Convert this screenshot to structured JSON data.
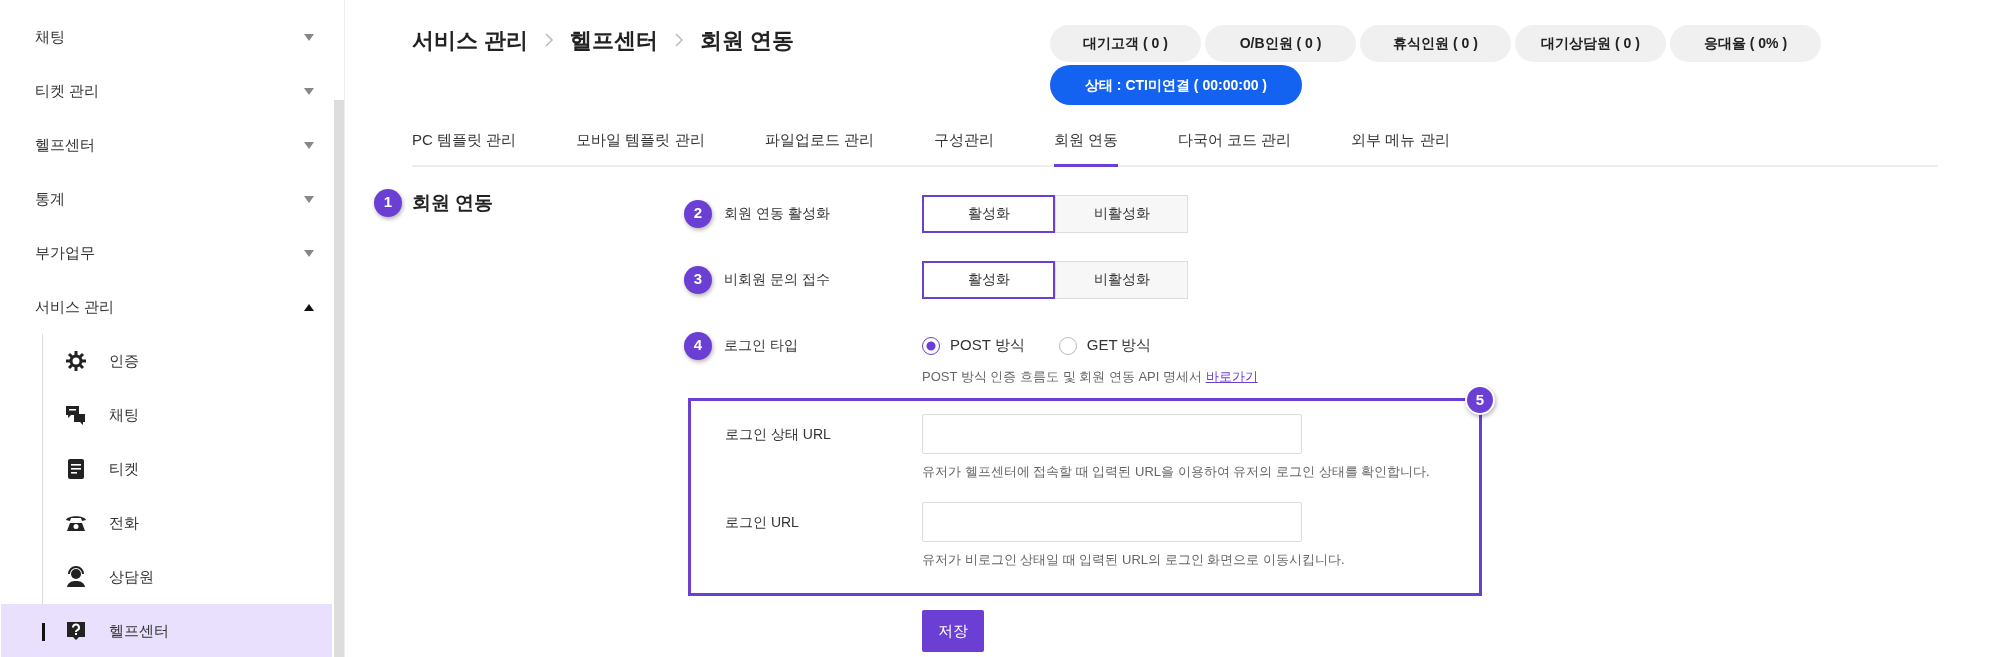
{
  "sidebar": {
    "items": [
      {
        "label": "채팅",
        "expanded": false
      },
      {
        "label": "티켓 관리",
        "expanded": false
      },
      {
        "label": "헬프센터",
        "expanded": false
      },
      {
        "label": "통계",
        "expanded": false
      },
      {
        "label": "부가업무",
        "expanded": false
      },
      {
        "label": "서비스 관리",
        "expanded": true,
        "children": [
          {
            "label": "인증",
            "selected": false
          },
          {
            "label": "채팅",
            "selected": false
          },
          {
            "label": "티켓",
            "selected": false
          },
          {
            "label": "전화",
            "selected": false
          },
          {
            "label": "상담원",
            "selected": false
          },
          {
            "label": "헬프센터",
            "selected": true
          }
        ]
      }
    ]
  },
  "breadcrumb": [
    "서비스 관리",
    "헬프센터",
    "회원 연동"
  ],
  "counters": [
    "대기고객 ( 0 )",
    "O/B인원 ( 0 )",
    "휴식인원 ( 0 )",
    "대기상담원 ( 0 )",
    "응대율 ( 0% )"
  ],
  "status": "상태 : CTI미연결 ( 00:00:00 )",
  "tabs": [
    {
      "label": "PC 템플릿 관리",
      "selected": false
    },
    {
      "label": "모바일 템플릿 관리",
      "selected": false
    },
    {
      "label": "파일업로드 관리",
      "selected": false
    },
    {
      "label": "구성관리",
      "selected": false
    },
    {
      "label": "회원 연동",
      "selected": true
    },
    {
      "label": "다국어 코드 관리",
      "selected": false
    },
    {
      "label": "외부 메뉴 관리",
      "selected": false
    }
  ],
  "section": {
    "number": "1",
    "title": "회원 연동"
  },
  "settings": [
    {
      "kind": "toggle",
      "number": "2",
      "label": "회원 연동 활성화",
      "options": [
        {
          "label": "활성화",
          "selected": true
        },
        {
          "label": "비활성화",
          "selected": false
        }
      ]
    },
    {
      "kind": "toggle",
      "number": "3",
      "label": "비회원 문의 접수",
      "options": [
        {
          "label": "활성화",
          "selected": true
        },
        {
          "label": "비활성화",
          "selected": false
        }
      ]
    },
    {
      "kind": "radio",
      "number": "4",
      "label": "로그인 타입",
      "options": [
        {
          "label": "POST 방식",
          "selected": true
        },
        {
          "label": "GET 방식",
          "selected": false
        }
      ],
      "help": "POST 방식 인증 흐름도 및 회원 연동 API 명세서",
      "link": "바로가기"
    }
  ],
  "url_group": {
    "number": "5",
    "fields": [
      {
        "label": "로그인 상태 URL",
        "help": "유저가 헬프센터에 접속할 때 입력된 URL을 이용하여 유저의 로그인 상태를 확인합니다."
      },
      {
        "label": "로그인 URL",
        "help": "유저가 비로그인 상태일 때 입력된 URL의 로그인 화면으로 이동시킵니다."
      }
    ]
  },
  "save_button": "저장"
}
